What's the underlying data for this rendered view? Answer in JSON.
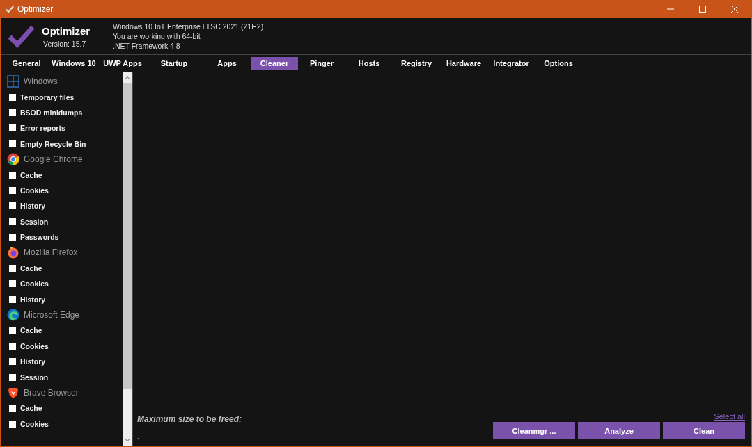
{
  "window": {
    "title": "Optimizer"
  },
  "header": {
    "app_name": "Optimizer",
    "version": "Version: 15.7",
    "info": [
      "Windows 10 IoT Enterprise LTSC 2021 (21H2)",
      "You are working with 64-bit",
      ".NET Framework 4.8"
    ]
  },
  "tabs": [
    {
      "label": "General",
      "selected": false
    },
    {
      "label": "Windows 10",
      "selected": false
    },
    {
      "label": "UWP Apps",
      "selected": false
    },
    {
      "label": "Startup",
      "selected": false
    },
    {
      "label": "Apps",
      "selected": false
    },
    {
      "label": "Cleaner",
      "selected": true
    },
    {
      "label": "Pinger",
      "selected": false
    },
    {
      "label": "Hosts",
      "selected": false
    },
    {
      "label": "Registry",
      "selected": false
    },
    {
      "label": "Hardware",
      "selected": false
    },
    {
      "label": "Integrator",
      "selected": false
    },
    {
      "label": "Options",
      "selected": false
    }
  ],
  "groups": [
    {
      "kind": "windows",
      "name": "Windows",
      "items": [
        {
          "label": "Temporary files",
          "checked": false
        },
        {
          "label": "BSOD minidumps",
          "checked": false
        },
        {
          "label": "Error reports",
          "checked": false
        },
        {
          "label": "Empty Recycle Bin",
          "checked": false
        }
      ]
    },
    {
      "kind": "chrome",
      "name": "Google Chrome",
      "items": [
        {
          "label": "Cache",
          "checked": false
        },
        {
          "label": "Cookies",
          "checked": false
        },
        {
          "label": "History",
          "checked": false
        },
        {
          "label": "Session",
          "checked": false
        },
        {
          "label": "Passwords",
          "checked": false
        }
      ]
    },
    {
      "kind": "firefox",
      "name": "Mozilla Firefox",
      "items": [
        {
          "label": "Cache",
          "checked": false
        },
        {
          "label": "Cookies",
          "checked": false
        },
        {
          "label": "History",
          "checked": false
        }
      ]
    },
    {
      "kind": "edge",
      "name": "Microsoft Edge",
      "items": [
        {
          "label": "Cache",
          "checked": false
        },
        {
          "label": "Cookies",
          "checked": false
        },
        {
          "label": "History",
          "checked": false
        },
        {
          "label": "Session",
          "checked": false
        }
      ]
    },
    {
      "kind": "brave",
      "name": "Brave Browser",
      "items": [
        {
          "label": "Cache",
          "checked": false
        },
        {
          "label": "Cookies",
          "checked": false
        }
      ]
    }
  ],
  "footer": {
    "max_size_label": "Maximum size to be freed:",
    "size_link": "-",
    "select_all": "Select all",
    "buttons": [
      "Cleanmgr ...",
      "Analyze",
      "Clean"
    ]
  }
}
